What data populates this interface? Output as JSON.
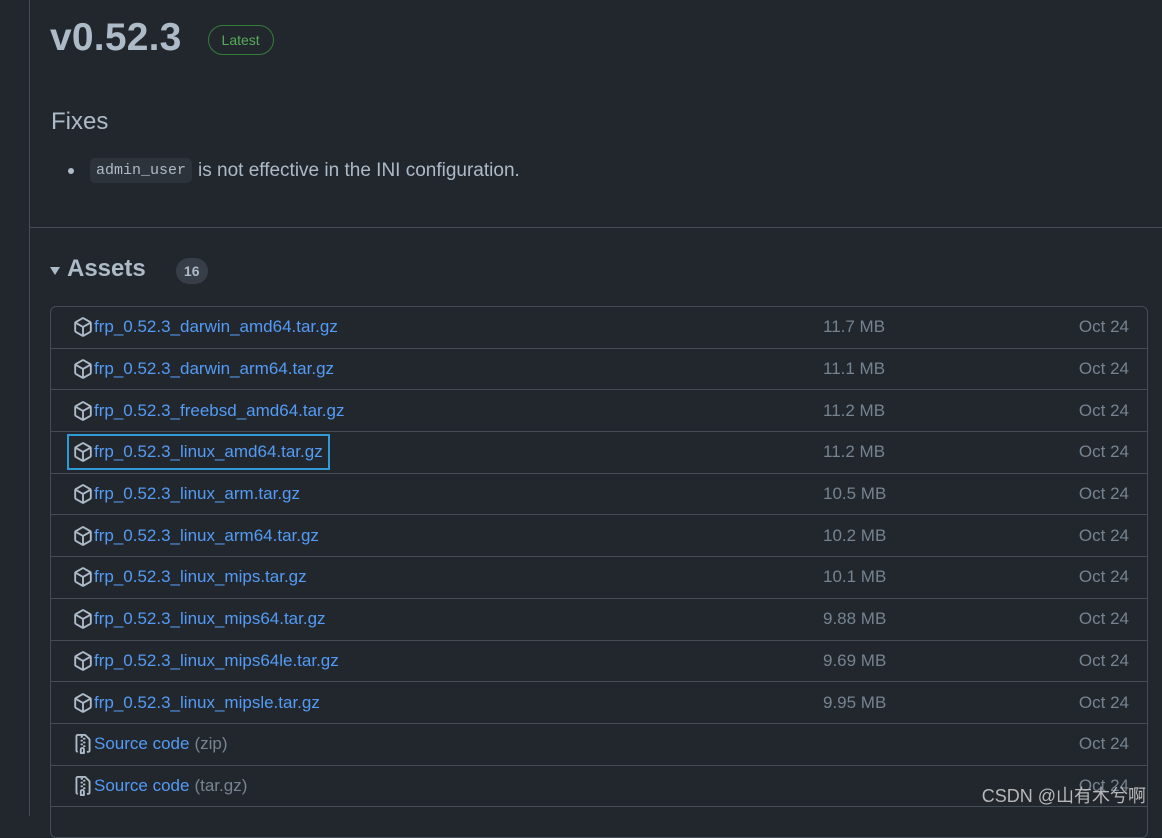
{
  "release": {
    "title": "v0.52.3",
    "badge": "Latest"
  },
  "fixes": {
    "heading": "Fixes",
    "items": [
      {
        "code": "admin_user",
        "text": "is not effective in the INI configuration."
      }
    ]
  },
  "assets": {
    "title": "Assets",
    "count": "16",
    "rows": [
      {
        "name": "frp_0.52.3_darwin_amd64.tar.gz",
        "size": "11.7 MB",
        "date": "Oct 24",
        "icon": "package-icon"
      },
      {
        "name": "frp_0.52.3_darwin_arm64.tar.gz",
        "size": "11.1 MB",
        "date": "Oct 24",
        "icon": "package-icon"
      },
      {
        "name": "frp_0.52.3_freebsd_amd64.tar.gz",
        "size": "11.2 MB",
        "date": "Oct 24",
        "icon": "package-icon"
      },
      {
        "name": "frp_0.52.3_linux_amd64.tar.gz",
        "size": "11.2 MB",
        "date": "Oct 24",
        "icon": "package-icon",
        "focused": true
      },
      {
        "name": "frp_0.52.3_linux_arm.tar.gz",
        "size": "10.5 MB",
        "date": "Oct 24",
        "icon": "package-icon"
      },
      {
        "name": "frp_0.52.3_linux_arm64.tar.gz",
        "size": "10.2 MB",
        "date": "Oct 24",
        "icon": "package-icon"
      },
      {
        "name": "frp_0.52.3_linux_mips.tar.gz",
        "size": "10.1 MB",
        "date": "Oct 24",
        "icon": "package-icon"
      },
      {
        "name": "frp_0.52.3_linux_mips64.tar.gz",
        "size": "9.88 MB",
        "date": "Oct 24",
        "icon": "package-icon"
      },
      {
        "name": "frp_0.52.3_linux_mips64le.tar.gz",
        "size": "9.69 MB",
        "date": "Oct 24",
        "icon": "package-icon"
      },
      {
        "name": "frp_0.52.3_linux_mipsle.tar.gz",
        "size": "9.95 MB",
        "date": "Oct 24",
        "icon": "package-icon"
      },
      {
        "name": "Source code",
        "suffix": "(zip)",
        "size": "",
        "date": "Oct 24",
        "icon": "file-zip-icon"
      },
      {
        "name": "Source code",
        "suffix": "(tar.gz)",
        "size": "",
        "date": "Oct 24",
        "icon": "file-zip-icon"
      }
    ]
  },
  "watermark": "CSDN @山有木兮啊",
  "colors": {
    "background": "#22272e",
    "link": "#539bf5",
    "muted": "#768390",
    "text": "#adbac7",
    "latest_badge": "#57ab5a",
    "focus_ring": "#2f9ad6"
  }
}
